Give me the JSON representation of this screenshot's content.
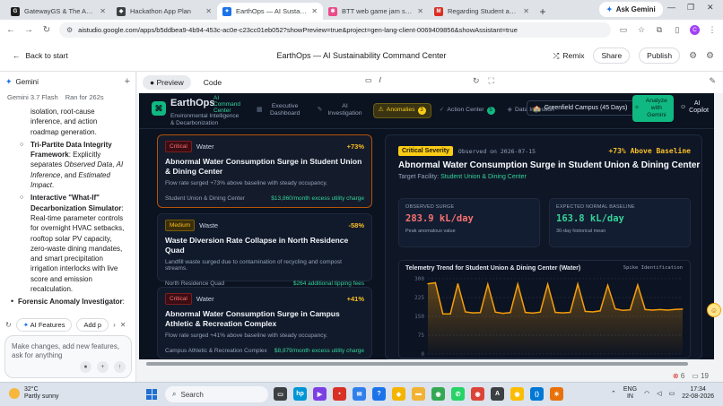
{
  "browser": {
    "tabs": [
      {
        "label": "GatewayGS & The AEI Initiative",
        "fav_color": "#1f1f1f",
        "fav_glyph": "G",
        "active": false
      },
      {
        "label": "Hackathon App Plan",
        "fav_color": "#3c4043",
        "fav_glyph": "◆",
        "active": false
      },
      {
        "label": "EarthOps — AI Sustainability Co…",
        "fav_color": "#1a73e8",
        "fav_glyph": "✦",
        "active": true
      },
      {
        "label": "BTT web game jam summer 2025",
        "fav_color": "#ea4c89",
        "fav_glyph": "✱",
        "active": false
      },
      {
        "label": "Regarding Student account access",
        "fav_color": "#d93025",
        "fav_glyph": "M",
        "active": false
      }
    ],
    "ask_gemini": "Ask Gemini",
    "url": "aistudio.google.com/apps/b5ddbea9-4b94-453c-ac0e-c23cc01eb052?showPreview=true&project=gen-lang-client-0069409856&showAssistant=true",
    "profile_initial": "C"
  },
  "app": {
    "back_label": "Back to start",
    "title": "EarthOps — AI Sustainability Command Center",
    "remix": "Remix",
    "share": "Share",
    "publish": "Publish"
  },
  "chat": {
    "assistant": "Gemini",
    "model": "Gemini 3.7 Flash",
    "ran_for": "Ran for 262s",
    "intro_lines": [
      "isolation, root-cause",
      "inference, and action",
      "roadmap generation."
    ],
    "item1_title": "Tri-Partite Data Integrity Framework",
    "item1_a": ": Explicitly separates ",
    "item1_b": "Observed Data",
    "item1_c": ", ",
    "item1_d": "AI Inference",
    "item1_e": ", and ",
    "item1_f": "Estimated Impact",
    "item1_g": ".",
    "item2_title": "Interactive \"What-If\" Decarbonization Simulator",
    "item2_body": ": Real-time parameter controls for overnight HVAC setbacks, rooftop solar PV capacity, zero-waste dining mandates, and smart precipitation irrigation interlocks with live score and emission recalculation.",
    "item3_title": "Forensic Anomaly Investigator",
    "item3_body": ":",
    "chips": [
      "AI Features",
      "Add p"
    ],
    "input_placeholder": "Make changes, add new features, ask for anything"
  },
  "preview": {
    "tab_preview": "Preview",
    "tab_code": "Code",
    "path": "/",
    "error_count": "6",
    "warn_count": "19"
  },
  "dashboard": {
    "brand": "EarthOps",
    "brand_sub": "AI Command Center",
    "tagline": "Environmental Intelligence & Decarbonization",
    "nav": [
      {
        "label": "Executive Dashboard",
        "icon": "▦",
        "active": false,
        "badge": ""
      },
      {
        "label": "AI Investigation",
        "icon": "✎",
        "active": false,
        "badge": ""
      },
      {
        "label": "Anomalies",
        "icon": "⚠",
        "active": true,
        "badge": "3"
      },
      {
        "label": "Action Center",
        "icon": "✓",
        "active": false,
        "badge": "5"
      },
      {
        "label": "Data Ingestion",
        "icon": "◈",
        "active": false,
        "badge": ""
      }
    ],
    "campus": "Greenfield Campus (45 Days)",
    "analyze": "Analyze with Gemini",
    "copilot": "AI Copilot",
    "anomalies": [
      {
        "severity": "Critical",
        "type": "Water",
        "pct": "+73%",
        "title": "Abnormal Water Consumption Surge in Student Union & Dining Center",
        "desc": "Flow rate surged +73% above baseline with steady occupancy.",
        "location": "Student Union & Dining Center",
        "cost": "$13,860/month excess utility charge"
      },
      {
        "severity": "Medium",
        "type": "Waste",
        "pct": "-58%",
        "title": "Waste Diversion Rate Collapse in North Residence Quad",
        "desc": "Landfill waste surged due to contamination of recycling and compost streams.",
        "location": "North Residence Quad",
        "cost": "$264 additional tipping fees"
      },
      {
        "severity": "Critical",
        "type": "Water",
        "pct": "+41%",
        "title": "Abnormal Water Consumption Surge in Campus Athletic & Recreation Complex",
        "desc": "Flow rate surged +41% above baseline with steady occupancy.",
        "location": "Campus Athletic & Recreation Complex",
        "cost": "$8,879/month excess utility charge"
      }
    ],
    "detail": {
      "severity": "Critical Severity",
      "observed": "Observed on 2026-07-15",
      "above": "+73% Above Baseline",
      "title": "Abnormal Water Consumption Surge in Student Union & Dining Center",
      "target_label": "Target Facility: ",
      "target": "Student Union & Dining Center",
      "observed_label": "OBSERVED SURGE",
      "observed_value": "283.9 kL/day",
      "observed_sub": "Peak anomalous value",
      "baseline_label": "EXPECTED NORMAL BASELINE",
      "baseline_value": "163.8 kL/day",
      "baseline_sub": "30-day historical mean",
      "chart_title": "Telemetry Trend for Student Union & Dining Center (Water)",
      "chart_legend": "Spike Identification"
    }
  },
  "chart_data": {
    "type": "area",
    "title": "Telemetry Trend for Student Union & Dining Center (Water)",
    "ylim": [
      0,
      300
    ],
    "yticks": [
      0,
      75,
      150,
      225,
      300
    ],
    "color": "#f59e0b",
    "values": [
      280,
      284,
      160,
      160,
      280,
      168,
      164,
      165,
      278,
      167,
      162,
      165,
      279,
      166,
      163,
      167,
      278,
      166,
      164,
      166,
      279,
      170,
      168,
      172,
      274,
      180,
      174,
      176,
      275,
      177,
      175,
      177,
      175,
      178,
      179
    ]
  },
  "taskbar": {
    "temp": "32°C",
    "condition": "Partly sunny",
    "search": "Search",
    "lang1": "ENG",
    "lang2": "IN",
    "time": "17:34",
    "date": "22-08-2026",
    "apps": [
      {
        "name": "file-explorer-app",
        "color": "#3c4043",
        "glyph": "▭"
      },
      {
        "name": "hp-app",
        "color": "#0096d6",
        "glyph": "hp"
      },
      {
        "name": "video-app",
        "color": "#7b3fe4",
        "glyph": "▶"
      },
      {
        "name": "toolbox-app",
        "color": "#d93025",
        "glyph": "▪"
      },
      {
        "name": "mail-app",
        "color": "#2f80ed",
        "glyph": "✉"
      },
      {
        "name": "help-app",
        "color": "#1a73e8",
        "glyph": "?"
      },
      {
        "name": "widgets-app",
        "color": "#f4b400",
        "glyph": "◆"
      },
      {
        "name": "folder-app",
        "color": "#f2b233",
        "glyph": "▬"
      },
      {
        "name": "chrome-app",
        "color": "#34a853",
        "glyph": "◉"
      },
      {
        "name": "whatsapp-app",
        "color": "#25d366",
        "glyph": "✆"
      },
      {
        "name": "chrome-profile-app",
        "color": "#db4437",
        "glyph": "◉"
      },
      {
        "name": "ai-studio-app",
        "color": "#3c4043",
        "glyph": "A"
      },
      {
        "name": "chrome-2-app",
        "color": "#fbbc04",
        "glyph": "◉"
      },
      {
        "name": "vscode-app",
        "color": "#0078d4",
        "glyph": "⟨⟩"
      },
      {
        "name": "spark-app",
        "color": "#e8710a",
        "glyph": "✳"
      }
    ]
  }
}
